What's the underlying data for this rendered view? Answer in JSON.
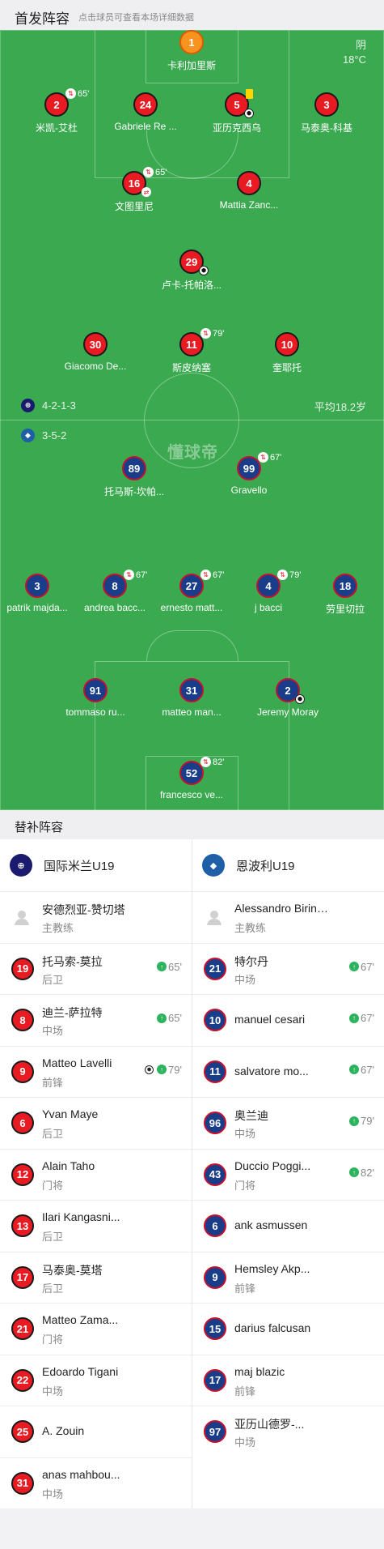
{
  "header": {
    "title": "首发阵容",
    "subtitle": "点击球员可查看本场详细数据"
  },
  "weather": {
    "condition": "阴",
    "temp": "18°C"
  },
  "home_formation": "4-2-1-3",
  "away_formation": "3-5-2",
  "avg_age": "平均18.2岁",
  "watermark": "懂球帝",
  "home_lineup": [
    {
      "num": "1",
      "name": "卡利加里斯",
      "color": "orange"
    },
    {
      "num": "2",
      "name": "米凯-艾杜",
      "sub": "65'"
    },
    {
      "num": "24",
      "name": "Gabriele Re ..."
    },
    {
      "num": "5",
      "name": "亚历克西乌",
      "card": "yellow",
      "goal": true
    },
    {
      "num": "3",
      "name": "马泰奥-科基"
    },
    {
      "num": "16",
      "name": "文图里尼",
      "sub": "65'",
      "swap": true
    },
    {
      "num": "4",
      "name": "Mattia Zanc..."
    },
    {
      "num": "29",
      "name": "卢卡-托帕洛...",
      "goal": true
    },
    {
      "num": "30",
      "name": "Giacomo De..."
    },
    {
      "num": "11",
      "name": "斯皮纳塞",
      "sub": "79'"
    },
    {
      "num": "10",
      "name": "奎耶托"
    }
  ],
  "away_lineup": [
    {
      "num": "89",
      "name": "托马斯-坎帕..."
    },
    {
      "num": "99",
      "name": "Gravello",
      "sub": "67'"
    },
    {
      "num": "3",
      "name": "patrik majda..."
    },
    {
      "num": "8",
      "name": "andrea bacc...",
      "sub": "67'"
    },
    {
      "num": "27",
      "name": "ernesto matt...",
      "sub": "67'"
    },
    {
      "num": "4",
      "name": "j bacci",
      "sub": "79'"
    },
    {
      "num": "18",
      "name": "劳里切拉"
    },
    {
      "num": "91",
      "name": "tommaso ru..."
    },
    {
      "num": "31",
      "name": "matteo man..."
    },
    {
      "num": "2",
      "name": "Jeremy Moray",
      "goal": true
    },
    {
      "num": "52",
      "name": "francesco ve...",
      "sub": "82'"
    }
  ],
  "subs_title": "替补阵容",
  "home": {
    "team": "国际米兰U19",
    "coach": {
      "name": "安德烈亚-赞切塔",
      "role": "主教练"
    },
    "subs": [
      {
        "num": "19",
        "name": "托马索-莫拉",
        "pos": "后卫",
        "in": "65'"
      },
      {
        "num": "8",
        "name": "迪兰-萨拉特",
        "pos": "中场",
        "in": "65'"
      },
      {
        "num": "9",
        "name": "Matteo Lavelli",
        "pos": "前锋",
        "in": "79'",
        "goal": true
      },
      {
        "num": "6",
        "name": "Yvan Maye",
        "pos": "后卫"
      },
      {
        "num": "12",
        "name": "Alain Taho",
        "pos": "门将"
      },
      {
        "num": "13",
        "name": "Ilari Kangasni...",
        "pos": "后卫"
      },
      {
        "num": "17",
        "name": "马泰奥-莫塔",
        "pos": "后卫"
      },
      {
        "num": "21",
        "name": "Matteo Zama...",
        "pos": "门将"
      },
      {
        "num": "22",
        "name": "Edoardo Tigani",
        "pos": "中场"
      },
      {
        "num": "25",
        "name": "A. Zouin",
        "pos": ""
      },
      {
        "num": "31",
        "name": "anas mahbou...",
        "pos": "中场"
      }
    ]
  },
  "away": {
    "team": "恩波利U19",
    "coach": {
      "name": "Alessandro Birindelli",
      "role": "主教练"
    },
    "subs": [
      {
        "num": "21",
        "name": "特尔丹",
        "pos": "中场",
        "in": "67'"
      },
      {
        "num": "10",
        "name": "manuel cesari",
        "pos": "",
        "in": "67'"
      },
      {
        "num": "11",
        "name": "salvatore mo...",
        "pos": "",
        "in": "67'"
      },
      {
        "num": "96",
        "name": "奥兰迪",
        "pos": "中场",
        "in": "79'"
      },
      {
        "num": "43",
        "name": "Duccio Poggi...",
        "pos": "门将",
        "in": "82'"
      },
      {
        "num": "6",
        "name": "ank asmussen",
        "pos": ""
      },
      {
        "num": "9",
        "name": "Hemsley Akp...",
        "pos": "前锋"
      },
      {
        "num": "15",
        "name": "darius falcusan",
        "pos": ""
      },
      {
        "num": "17",
        "name": "maj blazic",
        "pos": "前锋"
      },
      {
        "num": "97",
        "name": "亚历山德罗-...",
        "pos": "中场"
      }
    ]
  }
}
